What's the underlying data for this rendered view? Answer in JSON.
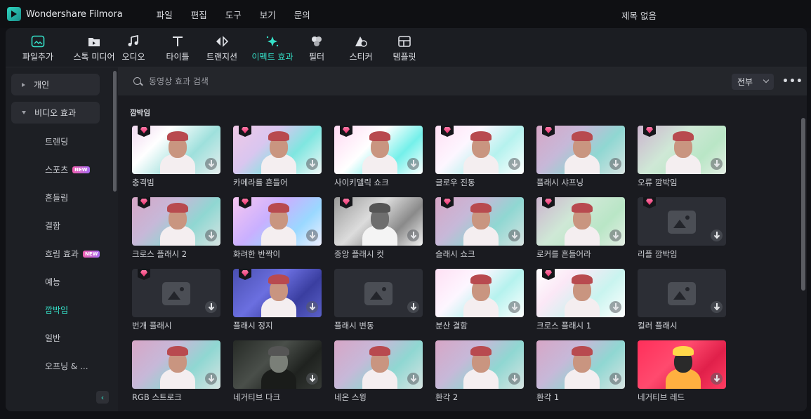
{
  "app": {
    "name": "Wondershare Filmora",
    "doc_title": "제목 없음"
  },
  "menu": [
    "파일",
    "편집",
    "도구",
    "보기",
    "문의"
  ],
  "toolbar": [
    {
      "label": "파일추가",
      "icon": "media-import-icon",
      "active": false
    },
    {
      "label": "스톡 미디어",
      "icon": "stock-media-icon",
      "active": false
    },
    {
      "label": "오디오",
      "icon": "music-note-icon",
      "active": false
    },
    {
      "label": "타이틀",
      "icon": "text-title-icon",
      "active": false
    },
    {
      "label": "트랜지션",
      "icon": "transition-icon",
      "active": false
    },
    {
      "label": "이펙트 효과",
      "icon": "effects-sparkle-icon",
      "active": true
    },
    {
      "label": "필터",
      "icon": "filter-icon",
      "active": false
    },
    {
      "label": "스티커",
      "icon": "sticker-icon",
      "active": false
    },
    {
      "label": "템플릿",
      "icon": "template-icon",
      "active": false
    }
  ],
  "sidebar": {
    "categories": [
      {
        "label": "개인",
        "expanded": false
      },
      {
        "label": "비디오 효과",
        "expanded": true
      }
    ],
    "items": [
      {
        "label": "트렌딩",
        "new": false,
        "active": false
      },
      {
        "label": "스포츠",
        "new": true,
        "active": false
      },
      {
        "label": "흔들림",
        "new": false,
        "active": false
      },
      {
        "label": "결함",
        "new": false,
        "active": false
      },
      {
        "label": "흐림 효과",
        "new": true,
        "active": false
      },
      {
        "label": "예능",
        "new": false,
        "active": false
      },
      {
        "label": "깜박임",
        "new": false,
        "active": true
      },
      {
        "label": "일반",
        "new": false,
        "active": false
      },
      {
        "label": "오프닝 & ...",
        "new": false,
        "active": false
      }
    ],
    "new_badge": "NEW",
    "collapse_glyph": "‹"
  },
  "search": {
    "placeholder": "동영상 효과 검색",
    "filter_value": "전부",
    "more_glyph": "•••"
  },
  "section_title": "깜박임",
  "effects": [
    {
      "label": "충격빔",
      "premium": true,
      "style": "flash-white"
    },
    {
      "label": "카메라를 흔들어",
      "premium": true,
      "style": "shake"
    },
    {
      "label": "사이키델릭 쇼크",
      "premium": true,
      "style": "psyche"
    },
    {
      "label": "글로우 진동",
      "premium": true,
      "style": "glow"
    },
    {
      "label": "플래시 샤프닝",
      "premium": true,
      "style": "normal"
    },
    {
      "label": "오류 깜박임",
      "premium": true,
      "style": "blur"
    },
    {
      "label": "크로스 플래시 2",
      "premium": true,
      "style": "normal"
    },
    {
      "label": "화려한 반짝이",
      "premium": true,
      "style": "purple"
    },
    {
      "label": "중앙 플래시 컷",
      "premium": true,
      "style": "mono"
    },
    {
      "label": "슬래시 쇼크",
      "premium": true,
      "style": "normal"
    },
    {
      "label": "로커를 흔들어라",
      "premium": true,
      "style": "blur"
    },
    {
      "label": "리플 깜박임",
      "premium": true,
      "style": "placeholder"
    },
    {
      "label": "번개 플래시",
      "premium": true,
      "style": "placeholder"
    },
    {
      "label": "플래시 정지",
      "premium": true,
      "style": "blue"
    },
    {
      "label": "플래시 변동",
      "premium": false,
      "style": "placeholder"
    },
    {
      "label": "분산 결함",
      "premium": false,
      "style": "glow"
    },
    {
      "label": "크로스 플래시 1",
      "premium": true,
      "style": "flash-blur"
    },
    {
      "label": "컬러 플래시",
      "premium": false,
      "style": "placeholder"
    },
    {
      "label": "RGB 스트로크",
      "premium": false,
      "style": "normal"
    },
    {
      "label": "네거티브 다크",
      "premium": false,
      "style": "dark"
    },
    {
      "label": "네온 스윙",
      "premium": false,
      "style": "normal"
    },
    {
      "label": "환각 2",
      "premium": false,
      "style": "normal"
    },
    {
      "label": "환각 1",
      "premium": false,
      "style": "normal"
    },
    {
      "label": "네거티브 레드",
      "premium": false,
      "style": "red"
    }
  ]
}
